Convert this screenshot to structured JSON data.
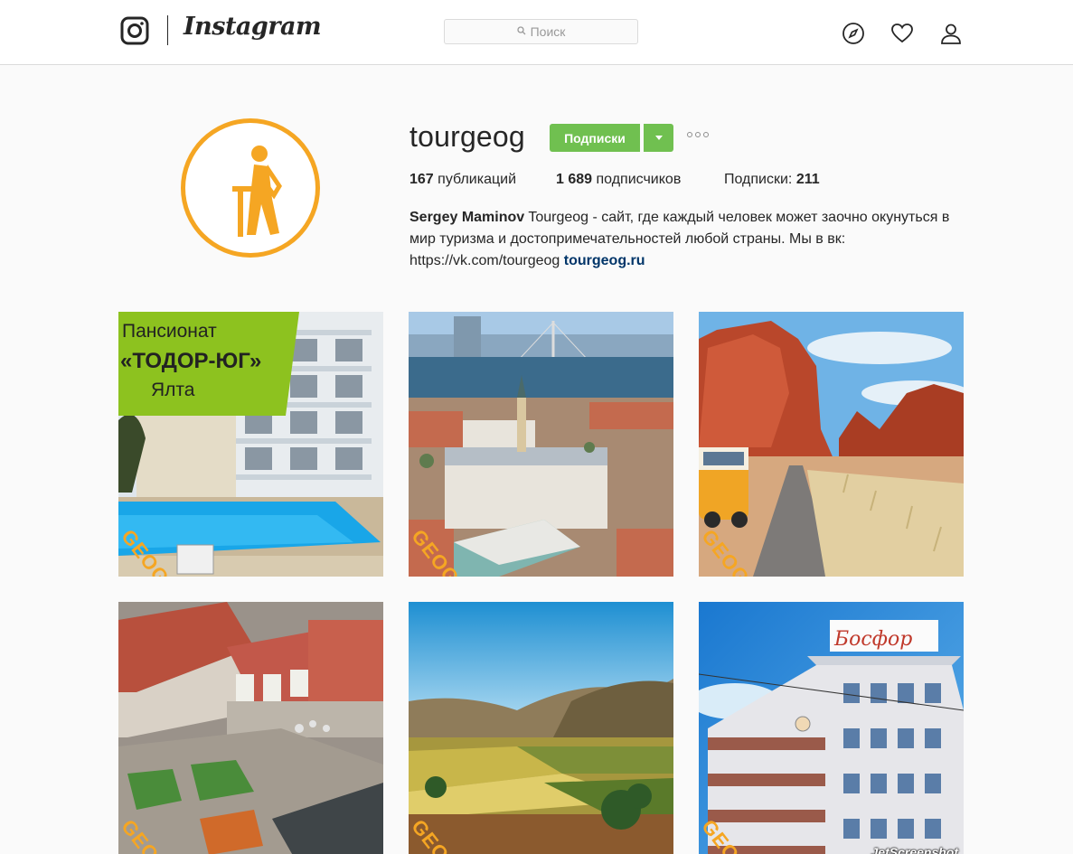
{
  "nav": {
    "wordmark": "Instagram",
    "search_placeholder": "Поиск",
    "icons": [
      "instagram-glyph-icon",
      "search-icon",
      "compass-icon",
      "heart-icon",
      "user-icon"
    ]
  },
  "profile": {
    "username": "tourgeog",
    "follow_label": "Подписки",
    "stats": {
      "posts_count": "167",
      "posts_label": "публикаций",
      "followers_count": "1 689",
      "followers_label": "подписчиков",
      "following_label": "Подписки:",
      "following_count": "211"
    },
    "bio": {
      "name": "Sergey Maminov",
      "text": "Tourgeog - сайт, где каждый человек может заочно окунуться в мир туризма и достопримечательностей любой страны. Мы в вк: https://vk.com/tourgeog",
      "link": "tourgeog.ru"
    }
  },
  "posts": [
    {
      "overlay_line1": "Пансионат",
      "overlay_line2": "«ТОДОР-ЮГ»",
      "overlay_line3": "Ялта",
      "watermark": "GEOG"
    },
    {
      "watermark": "GEOG"
    },
    {
      "watermark": "GEOG"
    },
    {
      "watermark": "GEOG"
    },
    {
      "watermark": "GEOG"
    },
    {
      "sign": "Босфор",
      "watermark": "GEOG"
    }
  ],
  "screenshot_tool_watermark": "JetScreenshot",
  "colors": {
    "accent_green": "#70c050",
    "brand_orange": "#f5a623",
    "link": "#003569"
  }
}
